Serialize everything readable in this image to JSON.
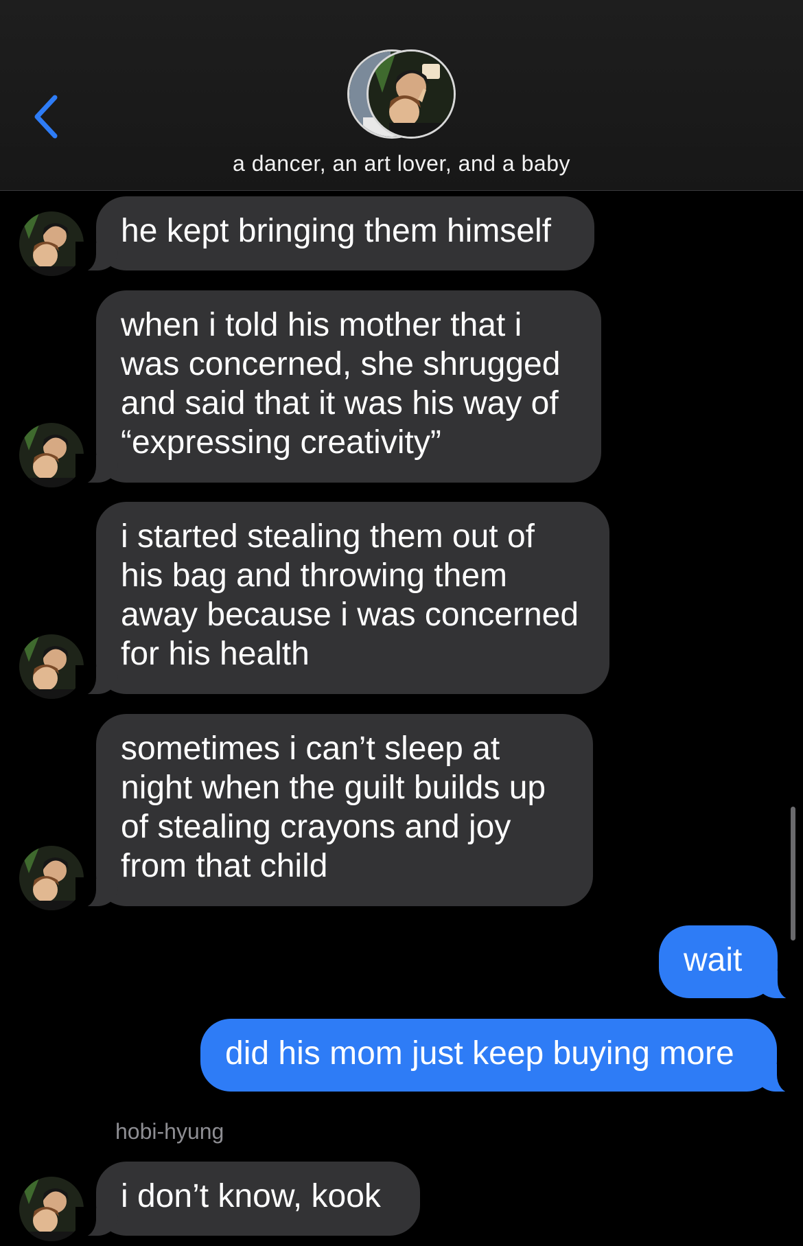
{
  "header": {
    "back_icon": "chevron-left-icon",
    "group_title": "a dancer, an art lover, and a baby"
  },
  "colors": {
    "accent": "#2e7cf6",
    "incoming_bubble": "#333335",
    "background": "#000000",
    "sender_label": "#8e8e93"
  },
  "messages": [
    {
      "direction": "incoming",
      "text": "he kept bringing them himself"
    },
    {
      "direction": "incoming",
      "text": "when i told his mother that i was concerned, she shrugged and said that it was his way of “expressing creativity”"
    },
    {
      "direction": "incoming",
      "text": "i started stealing them out of his bag and throwing them away because i was concerned for his health"
    },
    {
      "direction": "incoming",
      "text": "sometimes i can’t sleep at night when the guilt builds up of stealing crayons and joy from that child"
    },
    {
      "direction": "outgoing",
      "text": "wait"
    },
    {
      "direction": "outgoing",
      "text": "did his mom just keep buying more"
    },
    {
      "direction": "incoming",
      "sender": "hobi-hyung",
      "text": "i don’t know, kook"
    }
  ]
}
